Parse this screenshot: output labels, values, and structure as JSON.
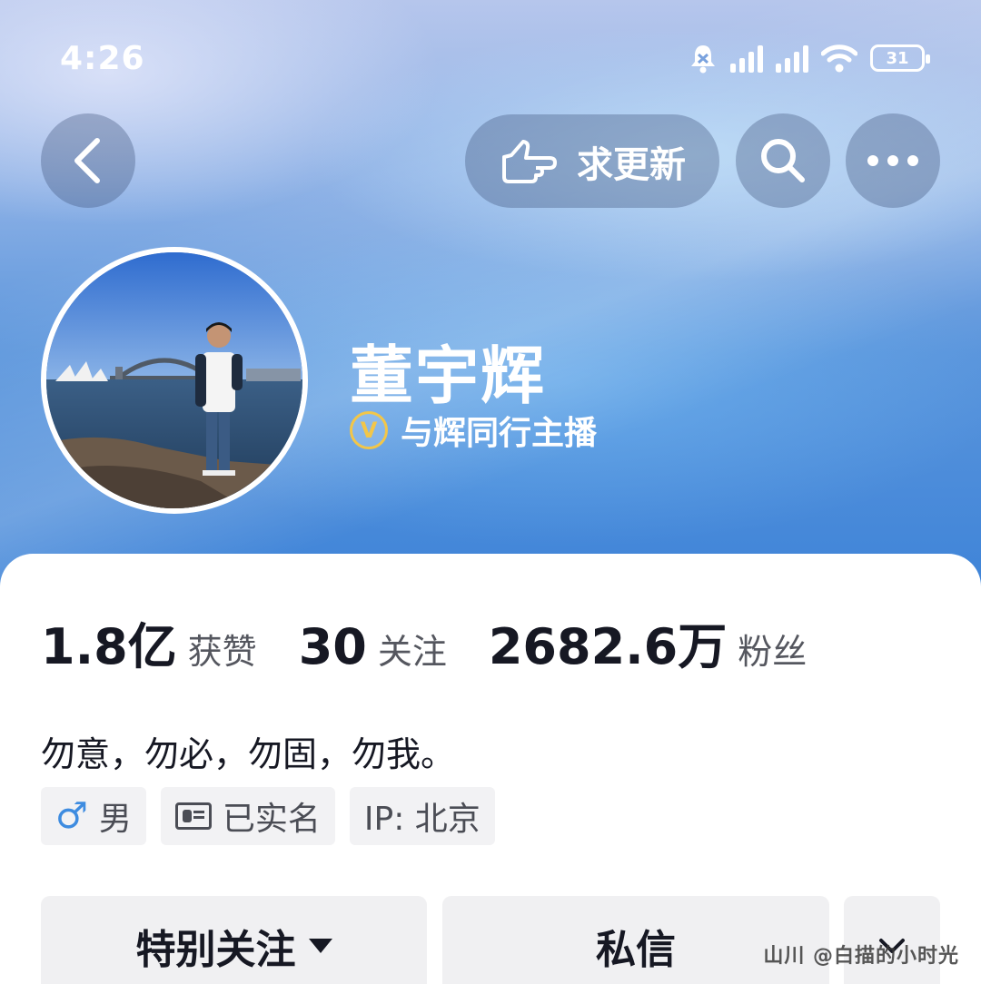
{
  "status_bar": {
    "time": "4:26",
    "battery": "31"
  },
  "header": {
    "update_button_label": "求更新",
    "icons": {
      "back": "chevron-left-icon",
      "update": "pointing-hand-icon",
      "search": "search-icon",
      "more": "more-dots-icon"
    }
  },
  "profile": {
    "name": "董宇辉",
    "verification": "与辉同行主播",
    "verification_badge": "V",
    "bio": "勿意，勿必，勿固，勿我。"
  },
  "stats": [
    {
      "value": "1.8亿",
      "label": "获赞"
    },
    {
      "value": "30",
      "label": "关注"
    },
    {
      "value": "2682.6万",
      "label": "粉丝"
    }
  ],
  "tags": {
    "gender": "男",
    "realname": "已实名",
    "ip": "IP: 北京"
  },
  "actions": {
    "follow": "特别关注",
    "message": "私信"
  },
  "watermark": "山川 @白描的小时光",
  "colors": {
    "header_blue": "#3f84d8",
    "verify_gold": "#f2c649",
    "gender_blue": "#3e8ce0"
  }
}
